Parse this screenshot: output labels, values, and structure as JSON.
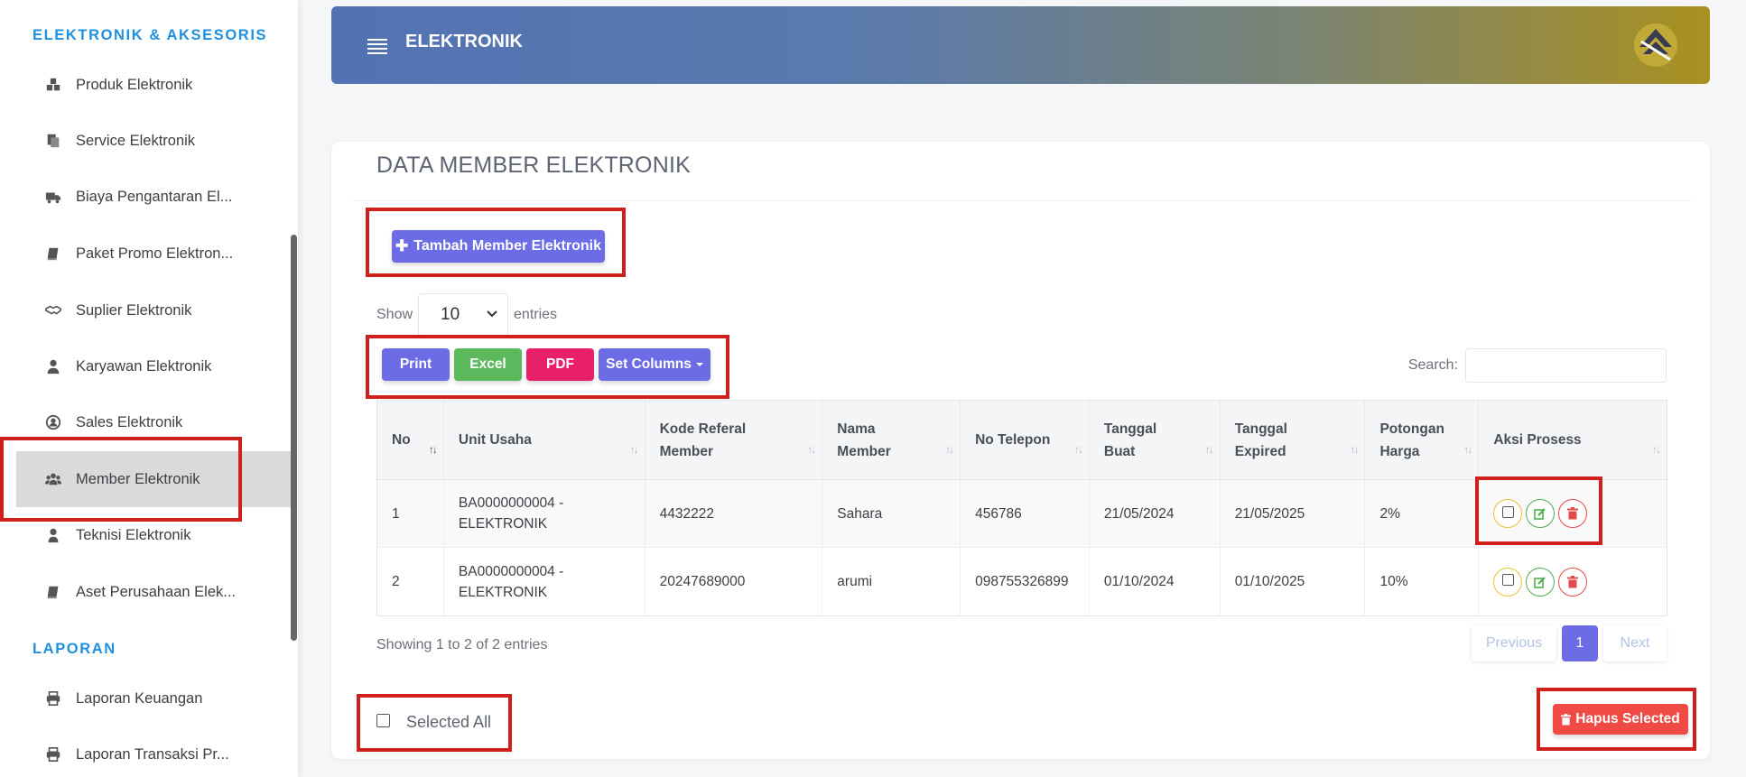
{
  "sidebar": {
    "section1": "ELEKTRONIK & AKSESORIS",
    "items": [
      {
        "label": "Produk Elektronik",
        "icon": "cubes-icon"
      },
      {
        "label": "Service Elektronik",
        "icon": "copy-icon"
      },
      {
        "label": "Biaya Pengantaran El...",
        "icon": "truck-icon"
      },
      {
        "label": "Paket Promo Elektron...",
        "icon": "book-icon"
      },
      {
        "label": "Suplier Elektronik",
        "icon": "handshake-icon"
      },
      {
        "label": "Karyawan Elektronik",
        "icon": "user-tie-icon"
      },
      {
        "label": "Sales Elektronik",
        "icon": "user-circle-icon"
      },
      {
        "label": "Member Elektronik",
        "icon": "users-icon",
        "active": true
      },
      {
        "label": "Teknisi Elektronik",
        "icon": "user-icon"
      },
      {
        "label": "Aset Perusahaan Elek...",
        "icon": "book-icon"
      }
    ],
    "section2": "LAPORAN",
    "reports": [
      {
        "label": "Laporan Keuangan",
        "icon": "print-icon"
      },
      {
        "label": "Laporan Transaksi Pr...",
        "icon": "print-icon"
      }
    ]
  },
  "header": {
    "title": "ELEKTRONIK"
  },
  "card": {
    "title": "DATA MEMBER ELEKTRONIK",
    "add_button": "Tambah Member Elektronik",
    "show_label": "Show",
    "entries_label": "entries",
    "page_size": "10",
    "export": {
      "print": "Print",
      "excel": "Excel",
      "pdf": "PDF",
      "columns": "Set Columns"
    },
    "search_label": "Search:",
    "search_value": ""
  },
  "table": {
    "headers": [
      [
        "No"
      ],
      [
        "Unit Usaha"
      ],
      [
        "Kode Referal",
        "Member"
      ],
      [
        "Nama",
        "Member"
      ],
      [
        "No Telepon"
      ],
      [
        "Tanggal",
        "Buat"
      ],
      [
        "Tanggal",
        "Expired"
      ],
      [
        "Potongan",
        "Harga"
      ],
      [
        "Aksi Prosess"
      ]
    ],
    "rows": [
      {
        "no": "1",
        "unit1": "BA0000000004 -",
        "unit2": "ELEKTRONIK",
        "kode": "4432222",
        "nama": "Sahara",
        "telp": "456786",
        "buat": "21/05/2024",
        "expired": "21/05/2025",
        "potongan": "2%"
      },
      {
        "no": "2",
        "unit1": "BA0000000004 -",
        "unit2": "ELEKTRONIK",
        "kode": "20247689000",
        "nama": "arumi",
        "telp": "098755326899",
        "buat": "01/10/2024",
        "expired": "01/10/2025",
        "potongan": "10%"
      }
    ]
  },
  "footer": {
    "info": "Showing 1 to 2 of 2 entries",
    "prev": "Previous",
    "page": "1",
    "next": "Next",
    "select_all": "Selected All",
    "delete_selected": "Hapus Selected"
  },
  "colors": {
    "accent": "#6c6ce6",
    "success": "#5cb85c",
    "pdf": "#e8206a",
    "danger": "#f04a44",
    "heading": "#1e8fe1",
    "annotation": "#d0201e"
  }
}
